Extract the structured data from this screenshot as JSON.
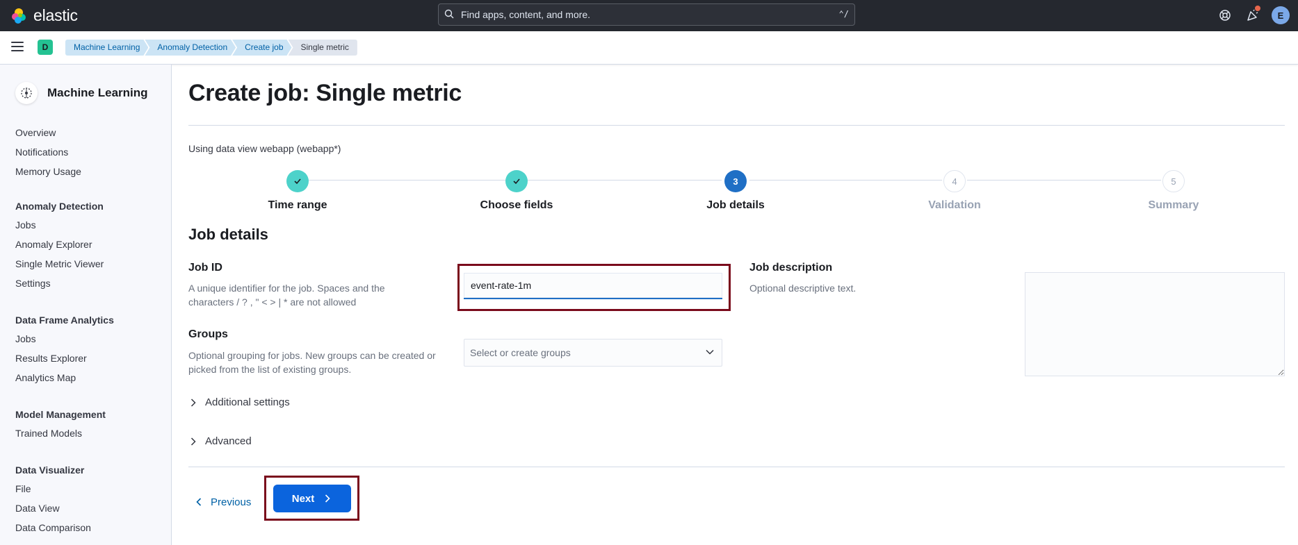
{
  "header": {
    "logo_text": "elastic",
    "search_placeholder": "Find apps, content, and more.",
    "search_shortcut": "⌃/",
    "avatar_initial": "E"
  },
  "breadcrumbs": {
    "space_initial": "D",
    "items": [
      "Machine Learning",
      "Anomaly Detection",
      "Create job",
      "Single metric"
    ]
  },
  "sidebar": {
    "title": "Machine Learning",
    "top_items": [
      "Overview",
      "Notifications",
      "Memory Usage"
    ],
    "groups": [
      {
        "title": "Anomaly Detection",
        "items": [
          "Jobs",
          "Anomaly Explorer",
          "Single Metric Viewer",
          "Settings"
        ]
      },
      {
        "title": "Data Frame Analytics",
        "items": [
          "Jobs",
          "Results Explorer",
          "Analytics Map"
        ]
      },
      {
        "title": "Model Management",
        "items": [
          "Trained Models"
        ]
      },
      {
        "title": "Data Visualizer",
        "items": [
          "File",
          "Data View",
          "Data Comparison"
        ]
      }
    ]
  },
  "main": {
    "title": "Create job: Single metric",
    "data_view_text": "Using data view webapp (webapp*)",
    "steps": [
      {
        "number": "1",
        "label": "Time range",
        "state": "done"
      },
      {
        "number": "2",
        "label": "Choose fields",
        "state": "done"
      },
      {
        "number": "3",
        "label": "Job details",
        "state": "current"
      },
      {
        "number": "4",
        "label": "Validation",
        "state": "todo"
      },
      {
        "number": "5",
        "label": "Summary",
        "state": "todo"
      }
    ],
    "section_title": "Job details",
    "job_id": {
      "title": "Job ID",
      "description": "A unique identifier for the job. Spaces and the characters / ? , \" < > | * are not allowed",
      "value": "event-rate-1m"
    },
    "groups": {
      "title": "Groups",
      "description": "Optional grouping for jobs. New groups can be created or picked from the list of existing groups.",
      "placeholder": "Select or create groups"
    },
    "job_description": {
      "title": "Job description",
      "description": "Optional descriptive text.",
      "value": ""
    },
    "accordions": [
      "Additional settings",
      "Advanced"
    ],
    "buttons": {
      "previous": "Previous",
      "next": "Next"
    }
  },
  "colors": {
    "header_bg": "#25282f",
    "primary": "#0b64dd",
    "step_done": "#4dd2ca",
    "step_current": "#1f6fc5",
    "highlight_border": "#7a0b1c",
    "space_badge": "#24c292"
  }
}
